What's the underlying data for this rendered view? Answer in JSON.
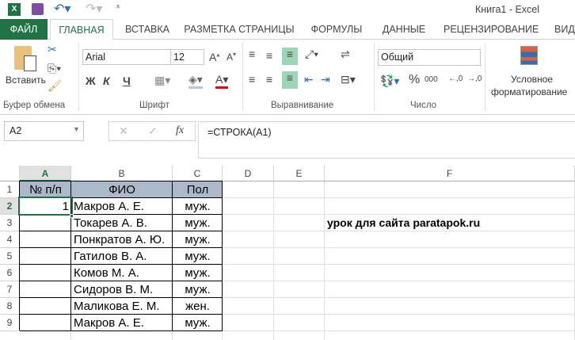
{
  "title": "Книга1 - Excel",
  "tabs": [
    "ФАЙЛ",
    "ГЛАВНАЯ",
    "ВСТАВКА",
    "РАЗМЕТКА СТРАНИЦЫ",
    "ФОРМУЛЫ",
    "ДАННЫЕ",
    "РЕЦЕНЗИРОВАНИЕ",
    "ВИД"
  ],
  "ribbon": {
    "paste_label": "Вставить",
    "font_name": "Arial",
    "font_size": "12",
    "bold": "Ж",
    "italic": "К",
    "underline": "Ч",
    "number_format": "Общий",
    "conditional_1": "Условное",
    "conditional_2": "форматирование",
    "groups": [
      "Буфер обмена",
      "Шрифт",
      "Выравнивание",
      "Число"
    ]
  },
  "name_box": "A2",
  "formula": "=СТРОКА(A1)",
  "fx": "fx",
  "columns": [
    "A",
    "B",
    "C",
    "D",
    "E",
    "F"
  ],
  "rows": [
    "1",
    "2",
    "3",
    "4",
    "5",
    "6",
    "7",
    "8",
    "9"
  ],
  "table": {
    "headers": [
      "№ п/п",
      "ФИО",
      "Пол"
    ],
    "a2": "1",
    "names": [
      "Макров А. Е.",
      "Токарев А. В.",
      "Понкратов А. Ю.",
      "Гатилов В. А.",
      "Комов М. А.",
      "Сидоров В. М.",
      "Маликова Е. М.",
      "Макров А. Е."
    ],
    "genders": [
      "муж.",
      "муж.",
      "муж.",
      "муж.",
      "муж.",
      "муж.",
      "жен.",
      "муж."
    ]
  },
  "note": "урок для сайта paratapok.ru",
  "colors": {
    "accent": "#217346",
    "header_fill": "#acb9ca"
  }
}
